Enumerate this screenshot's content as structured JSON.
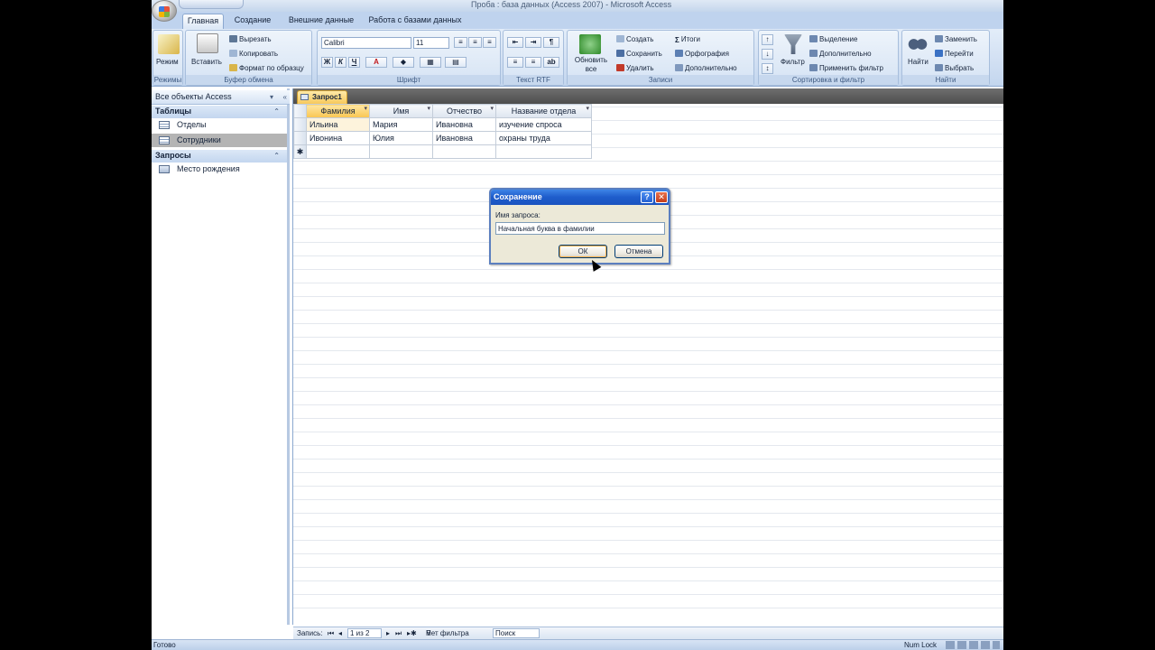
{
  "window": {
    "title": "Проба : база данных (Access 2007) - Microsoft Access"
  },
  "tabs": [
    "Главная",
    "Создание",
    "Внешние данные",
    "Работа с базами данных"
  ],
  "ribbon": {
    "groups": {
      "views": {
        "label": "Режимы",
        "mode_btn": "Режим"
      },
      "clipboard": {
        "label": "Буфер обмена",
        "paste": "Вставить",
        "cut": "Вырезать",
        "copy": "Копировать",
        "format_painter": "Формат по образцу"
      },
      "font": {
        "label": "Шрифт",
        "font_name": "Calibri",
        "font_size": "11",
        "bold": "Ж",
        "italic": "К",
        "underline": "Ч",
        "color": "A"
      },
      "rtf": {
        "label": "Текст RTF"
      },
      "records": {
        "label": "Записи",
        "refresh": "Обновить все",
        "new": "Создать",
        "save": "Сохранить",
        "delete": "Удалить",
        "totals": "Итоги",
        "spelling": "Орфография",
        "more": "Дополнительно"
      },
      "sortfilter": {
        "label": "Сортировка и фильтр",
        "filter": "Фильтр",
        "selection": "Выделение",
        "advanced": "Дополнительно",
        "apply": "Применить фильтр"
      },
      "find": {
        "label": "Найти",
        "find": "Найти",
        "replace": "Заменить",
        "goto": "Перейти",
        "select": "Выбрать"
      }
    }
  },
  "nav": {
    "header": "Все объекты Access",
    "categories": [
      {
        "name": "Таблицы",
        "items": [
          "Отделы",
          "Сотрудники"
        ]
      },
      {
        "name": "Запросы",
        "items": [
          "Место рождения"
        ]
      }
    ]
  },
  "document": {
    "tab": "Запрос1",
    "columns": [
      "Фамилия",
      "Имя",
      "Отчество",
      "Название отдела"
    ],
    "rows": [
      [
        "Ильина",
        "Мария",
        "Ивановна",
        "изучение спроса"
      ],
      [
        "Ивонина",
        "Юлия",
        "Ивановна",
        "охраны труда"
      ]
    ],
    "new_row_marker": "✱"
  },
  "recbar": {
    "label": "Запись:",
    "position": "1 из 2",
    "filter": "Нет фильтра",
    "search": "Поиск"
  },
  "status": {
    "left": "Готово",
    "right": "Num Lock"
  },
  "dialog": {
    "title": "Сохранение",
    "help": "?",
    "close": "✕",
    "label": "Имя запроса:",
    "value": "Начальная буква в фамилии",
    "ok": "ОК",
    "cancel": "Отмена"
  },
  "colors": {
    "ribbon": "#d2e0f3",
    "tab_active": "#f7c95c",
    "dialog_title": "#1e5ccb"
  }
}
